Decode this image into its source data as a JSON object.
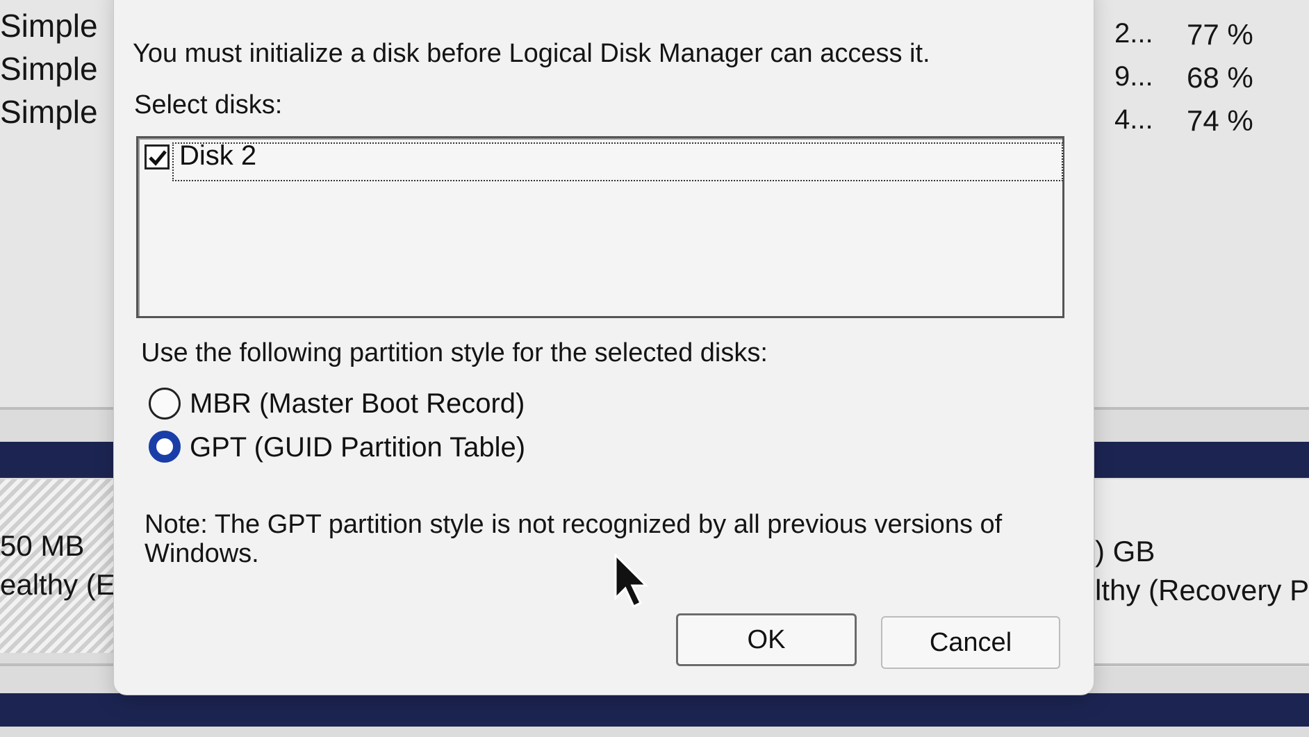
{
  "background": {
    "volume_types": [
      "Simple",
      "Simple",
      "Simple"
    ],
    "free_truncated": [
      "2...",
      "9...",
      "4..."
    ],
    "percent_free": [
      "77 %",
      "68 %",
      "74 %"
    ],
    "left_partition": {
      "size": "50 MB",
      "status": "ealthy (EF"
    },
    "right_partition": {
      "size": ") GB",
      "status": "lthy (Recovery P"
    }
  },
  "dialog": {
    "message": "You must initialize a disk before Logical Disk Manager can access it.",
    "select_label": "Select disks:",
    "disks": [
      {
        "label": "Disk 2",
        "checked": true
      }
    ],
    "partition_label": "Use the following partition style for the selected disks:",
    "options": [
      {
        "label": "MBR (Master Boot Record)",
        "selected": false
      },
      {
        "label": "GPT (GUID Partition Table)",
        "selected": true
      }
    ],
    "note_line1": "Note: The GPT partition style is not recognized by all previous versions of",
    "note_line2": "Windows.",
    "ok_label": "OK",
    "cancel_label": "Cancel"
  },
  "colors": {
    "radio_selected": "#1a3ea8",
    "band": "#1c2552"
  },
  "icons": [
    "checkmark-icon",
    "mouse-pointer-icon"
  ]
}
